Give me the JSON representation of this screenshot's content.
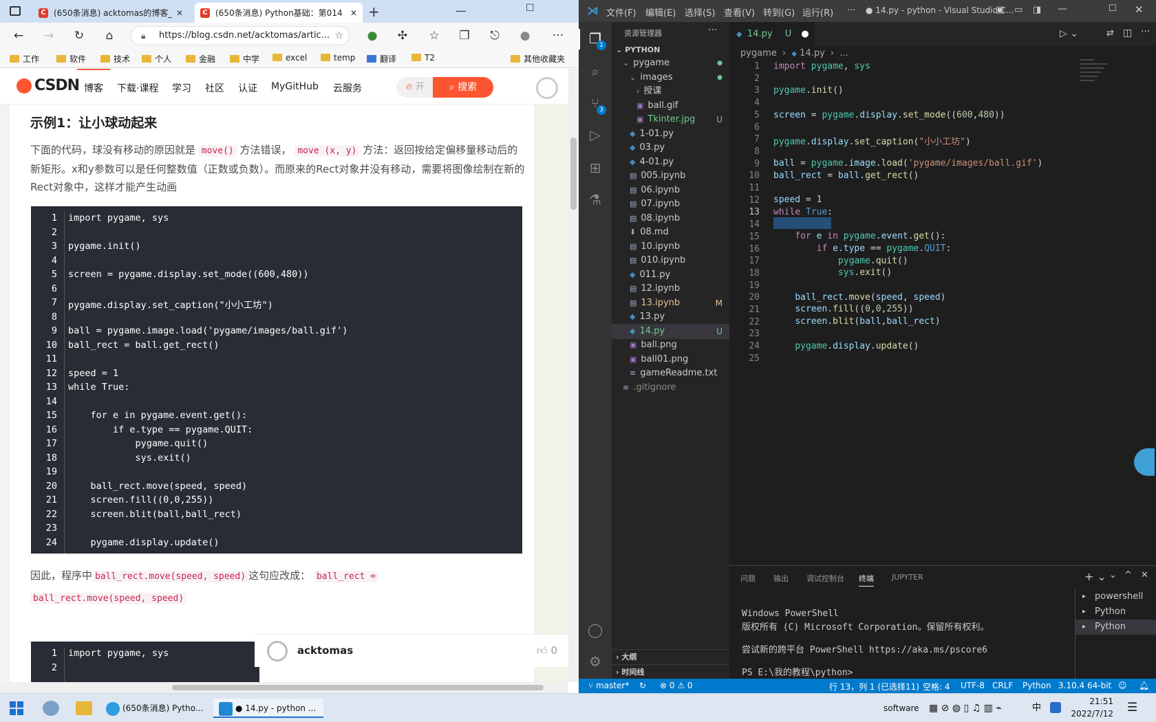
{
  "browser": {
    "tabs": [
      {
        "title": "(650条消息) acktomas的博客_CS"
      },
      {
        "title": "(650条消息) Python基础：第014"
      }
    ],
    "url": "https://blog.csdn.net/acktomas/artic...",
    "bookmarks": [
      "工作",
      "软件",
      "技术",
      "个人",
      "金融",
      "中学",
      "excel",
      "temp",
      "翻译",
      "T2",
      "其他收藏夹"
    ],
    "csdn": {
      "logo": "CSDN",
      "nav": [
        "博客",
        "下载·课程",
        "学习",
        "社区",
        "认证",
        "MyGitHub",
        "云服务"
      ],
      "search_placeholder": "开",
      "search_button": "搜索"
    },
    "article": {
      "heading": "示例1：让小球动起来",
      "para1_a": "下面的代码，球没有移动的原因就是",
      "para1_code1": "move()",
      "para1_b": "方法错误，",
      "para1_code2": "move (x, y)",
      "para1_c": "方法：返回按给定偏移量移动后的新矩形。x和y参数可以是任何整数值（正数或负数）。而原来的Rect对象并没有移动，需要将图像绘制在新的Rect对象中，这样才能产生动画",
      "code_lines": [
        "import pygame, sys",
        "",
        "pygame.init()",
        "",
        "screen = pygame.display.set_mode((600,480))",
        "",
        "pygame.display.set_caption(\"小小工坊\")",
        "",
        "ball = pygame.image.load('pygame/images/ball.gif')",
        "ball_rect = ball.get_rect()",
        "",
        "speed = 1",
        "while True:",
        "",
        "    for e in pygame.event.get():",
        "        if e.type == pygame.QUIT:",
        "            pygame.quit()",
        "            sys.exit()",
        "",
        "    ball_rect.move(speed, speed)",
        "    screen.fill((0,0,255))",
        "    screen.blit(ball,ball_rect)",
        "",
        "    pygame.display.update()"
      ],
      "para2_a": "因此，程序中",
      "para2_code1": "ball_rect.move(speed, speed)",
      "para2_b": "这句应改成：",
      "para2_code2": "ball_rect =",
      "para2_code3": "ball_rect.move(speed, speed)",
      "code2_lines": [
        "import pygame, sys",
        ""
      ],
      "author": "acktomas",
      "likes": "0"
    }
  },
  "vscode": {
    "menu": [
      "文件(F)",
      "编辑(E)",
      "选择(S)",
      "查看(V)",
      "转到(G)",
      "运行(R)",
      "···"
    ],
    "window_title": "● 14.py - python - Visual Studio C...",
    "explorer_title": "资源管理器",
    "root": "PYTHON",
    "tree": [
      {
        "name": "pygame",
        "indent": 1,
        "kind": "folder-open"
      },
      {
        "name": "images",
        "indent": 2,
        "kind": "folder-open"
      },
      {
        "name": "授课",
        "indent": 3,
        "kind": "folder"
      },
      {
        "name": "ball.gif",
        "indent": 3,
        "kind": "file"
      },
      {
        "name": "Tkinter.jpg",
        "indent": 3,
        "kind": "file",
        "badge": "U"
      },
      {
        "name": "1-01.py",
        "indent": 2,
        "kind": "file"
      },
      {
        "name": "03.py",
        "indent": 2,
        "kind": "file"
      },
      {
        "name": "4-01.py",
        "indent": 2,
        "kind": "file"
      },
      {
        "name": "005.ipynb",
        "indent": 2,
        "kind": "file"
      },
      {
        "name": "06.ipynb",
        "indent": 2,
        "kind": "file"
      },
      {
        "name": "07.ipynb",
        "indent": 2,
        "kind": "file"
      },
      {
        "name": "08.ipynb",
        "indent": 2,
        "kind": "file"
      },
      {
        "name": "08.md",
        "indent": 2,
        "kind": "file"
      },
      {
        "name": "10.ipynb",
        "indent": 2,
        "kind": "file"
      },
      {
        "name": "010.ipynb",
        "indent": 2,
        "kind": "file"
      },
      {
        "name": "011.py",
        "indent": 2,
        "kind": "file"
      },
      {
        "name": "12.ipynb",
        "indent": 2,
        "kind": "file"
      },
      {
        "name": "13.ipynb",
        "indent": 2,
        "kind": "file",
        "badge": "M"
      },
      {
        "name": "13.py",
        "indent": 2,
        "kind": "file"
      },
      {
        "name": "14.py",
        "indent": 2,
        "kind": "file",
        "badge": "U"
      },
      {
        "name": "ball.png",
        "indent": 2,
        "kind": "file"
      },
      {
        "name": "ball01.png",
        "indent": 2,
        "kind": "file"
      },
      {
        "name": "gameReadme.txt",
        "indent": 2,
        "kind": "file"
      },
      {
        "name": ".gitignore",
        "indent": 1,
        "kind": "file"
      }
    ],
    "outline": "大纲",
    "timeline": "时间线",
    "tab": {
      "name": "14.py",
      "status": "U"
    },
    "breadcrumb": [
      "pygame",
      "14.py",
      "..."
    ],
    "line_numbers": [
      "1",
      "2",
      "3",
      "4",
      "5",
      "6",
      "7",
      "8",
      "9",
      "10",
      "11",
      "12",
      "13",
      "14",
      "15",
      "16",
      "17",
      "18",
      "19",
      "20",
      "21",
      "22",
      "23",
      "24",
      "25"
    ],
    "panel_tabs": [
      "问题",
      "输出",
      "调试控制台",
      "终端",
      "JUPYTER"
    ],
    "terminals": [
      "powershell",
      "Python",
      "Python"
    ],
    "terminal_lines": [
      "Windows PowerShell",
      "版权所有 (C) Microsoft Corporation。保留所有权利。",
      "",
      "尝试新的跨平台 PowerShell https://aka.ms/pscore6",
      "",
      "PS E:\\我的教程\\python>"
    ],
    "status": {
      "branch": "master*",
      "problems": "⊗ 0 ⚠ 0",
      "position": "行 13，列 1 (已选择11)",
      "spaces": "空格: 4",
      "encoding": "UTF-8",
      "eol": "CRLF",
      "language": "Python",
      "interpreter": "3.10.4 64-bit"
    },
    "badges": {
      "explorer": "1",
      "scm": "3"
    }
  },
  "taskbar": {
    "items": [
      "(650条消息) Pytho...",
      "● 14.py - python ..."
    ],
    "tray_text": "software",
    "ime": "中",
    "time": "21:51",
    "date": "2022/7/12"
  },
  "colors": {
    "csdn_red": "#fc5531",
    "vscode_blue": "#007acc",
    "code_bg": "#282c34"
  }
}
